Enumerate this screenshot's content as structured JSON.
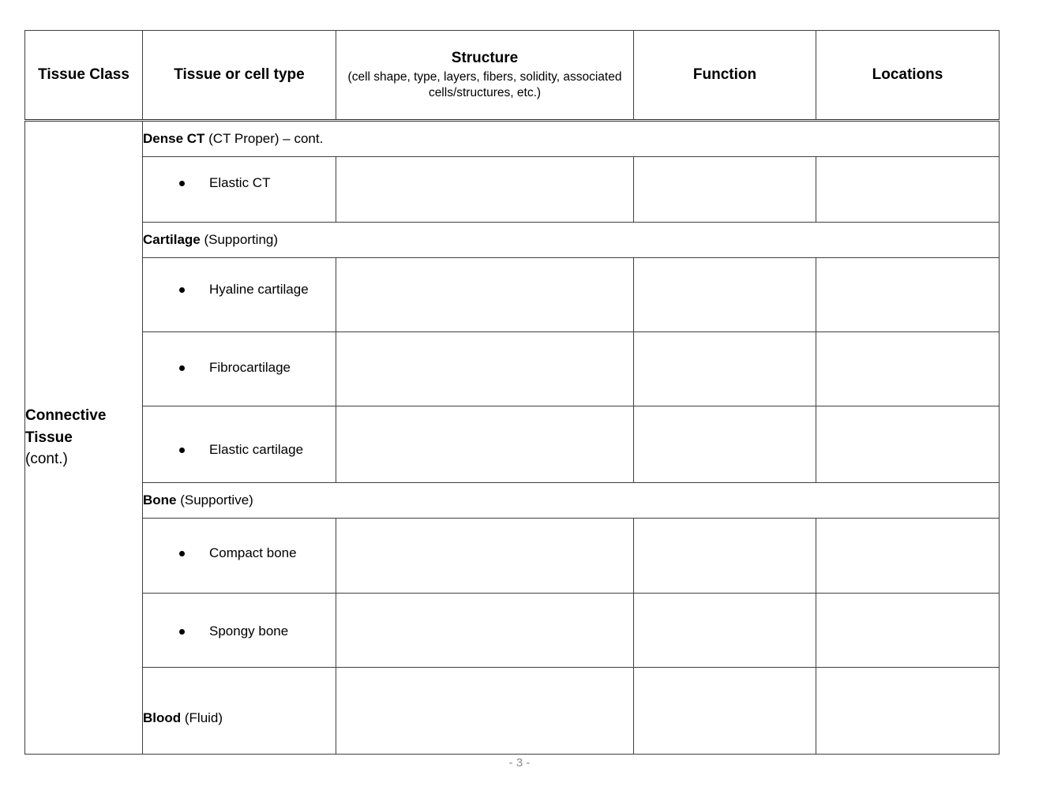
{
  "document": {
    "footer": "- 3 -"
  },
  "table": {
    "columns": [
      {
        "label": "Tissue Class"
      },
      {
        "label": "Tissue or cell type"
      },
      {
        "label": "Structure",
        "sublabel": "(cell shape, type, layers, fibers, solidity, associated cells/structures, etc.)"
      },
      {
        "label": "Function"
      },
      {
        "label": "Locations"
      }
    ],
    "tissue_class": {
      "name": "Connective Tissue",
      "continuation": "(cont.)"
    },
    "sections": [
      {
        "bold": "Dense CT",
        "regular": " (CT Proper) – cont.",
        "rows": [
          {
            "label": "Elastic CT",
            "bulleted": true,
            "structure": "",
            "function": "",
            "locations": ""
          }
        ]
      },
      {
        "bold": "Cartilage",
        "regular": " (Supporting)",
        "rows": [
          {
            "label": "Hyaline cartilage",
            "bulleted": true,
            "structure": "",
            "function": "",
            "locations": ""
          },
          {
            "label": "Fibrocartilage",
            "bulleted": true,
            "structure": "",
            "function": "",
            "locations": ""
          },
          {
            "label": "Elastic cartilage",
            "bulleted": true,
            "structure": "",
            "function": "",
            "locations": ""
          }
        ]
      },
      {
        "bold": "Bone",
        "regular": " (Supportive)",
        "rows": [
          {
            "label": "Compact bone",
            "bulleted": true,
            "structure": "",
            "function": "",
            "locations": ""
          },
          {
            "label": "Spongy bone",
            "bulleted": true,
            "structure": "",
            "function": "",
            "locations": ""
          }
        ]
      }
    ],
    "standalone_rows": [
      {
        "bold": "Blood",
        "regular": " (Fluid)",
        "structure": "",
        "function": "",
        "locations": ""
      }
    ]
  },
  "colors": {
    "border": "#3f3f3f",
    "section_shade": "#f2f2f2",
    "footer_text": "#8a8a8a"
  }
}
